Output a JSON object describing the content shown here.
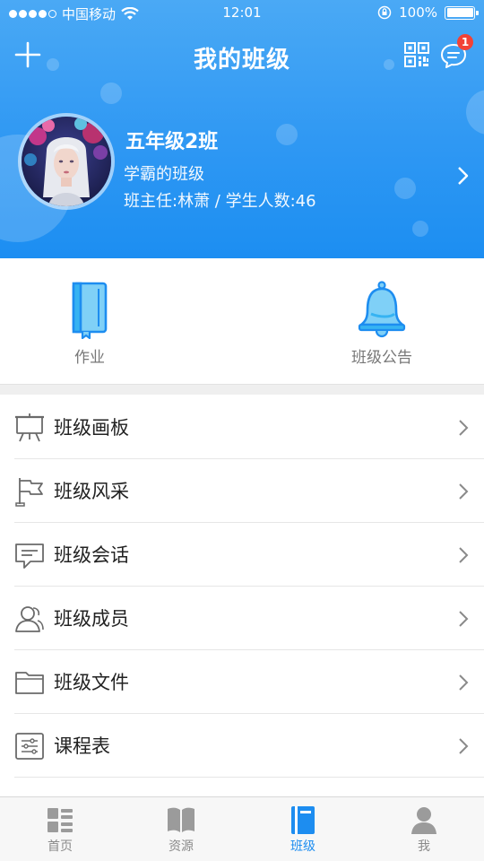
{
  "status_bar": {
    "carrier": "中国移动",
    "time": "12:01",
    "battery": "100%"
  },
  "header": {
    "title": "我的班级",
    "message_badge": "1"
  },
  "class_card": {
    "name": "五年级2班",
    "motto": "学霸的班级",
    "info": "班主任:林萧 / 学生人数:46"
  },
  "quick_actions": [
    {
      "label": "作业",
      "icon": "homework-book-icon"
    },
    {
      "label": "班级公告",
      "icon": "announcement-bell-icon"
    }
  ],
  "menu": [
    {
      "label": "班级画板",
      "icon": "easel-board-icon"
    },
    {
      "label": "班级风采",
      "icon": "flag-icon"
    },
    {
      "label": "班级会话",
      "icon": "chat-message-icon"
    },
    {
      "label": "班级成员",
      "icon": "members-icon"
    },
    {
      "label": "班级文件",
      "icon": "folder-icon"
    },
    {
      "label": "课程表",
      "icon": "schedule-list-icon"
    }
  ],
  "tabs": [
    {
      "label": "首页",
      "active": false
    },
    {
      "label": "资源",
      "active": false
    },
    {
      "label": "班级",
      "active": true
    },
    {
      "label": "我",
      "active": false
    }
  ],
  "colors": {
    "primary": "#1d8df0",
    "header_top": "#4aa9f5",
    "badge": "#f24236"
  }
}
